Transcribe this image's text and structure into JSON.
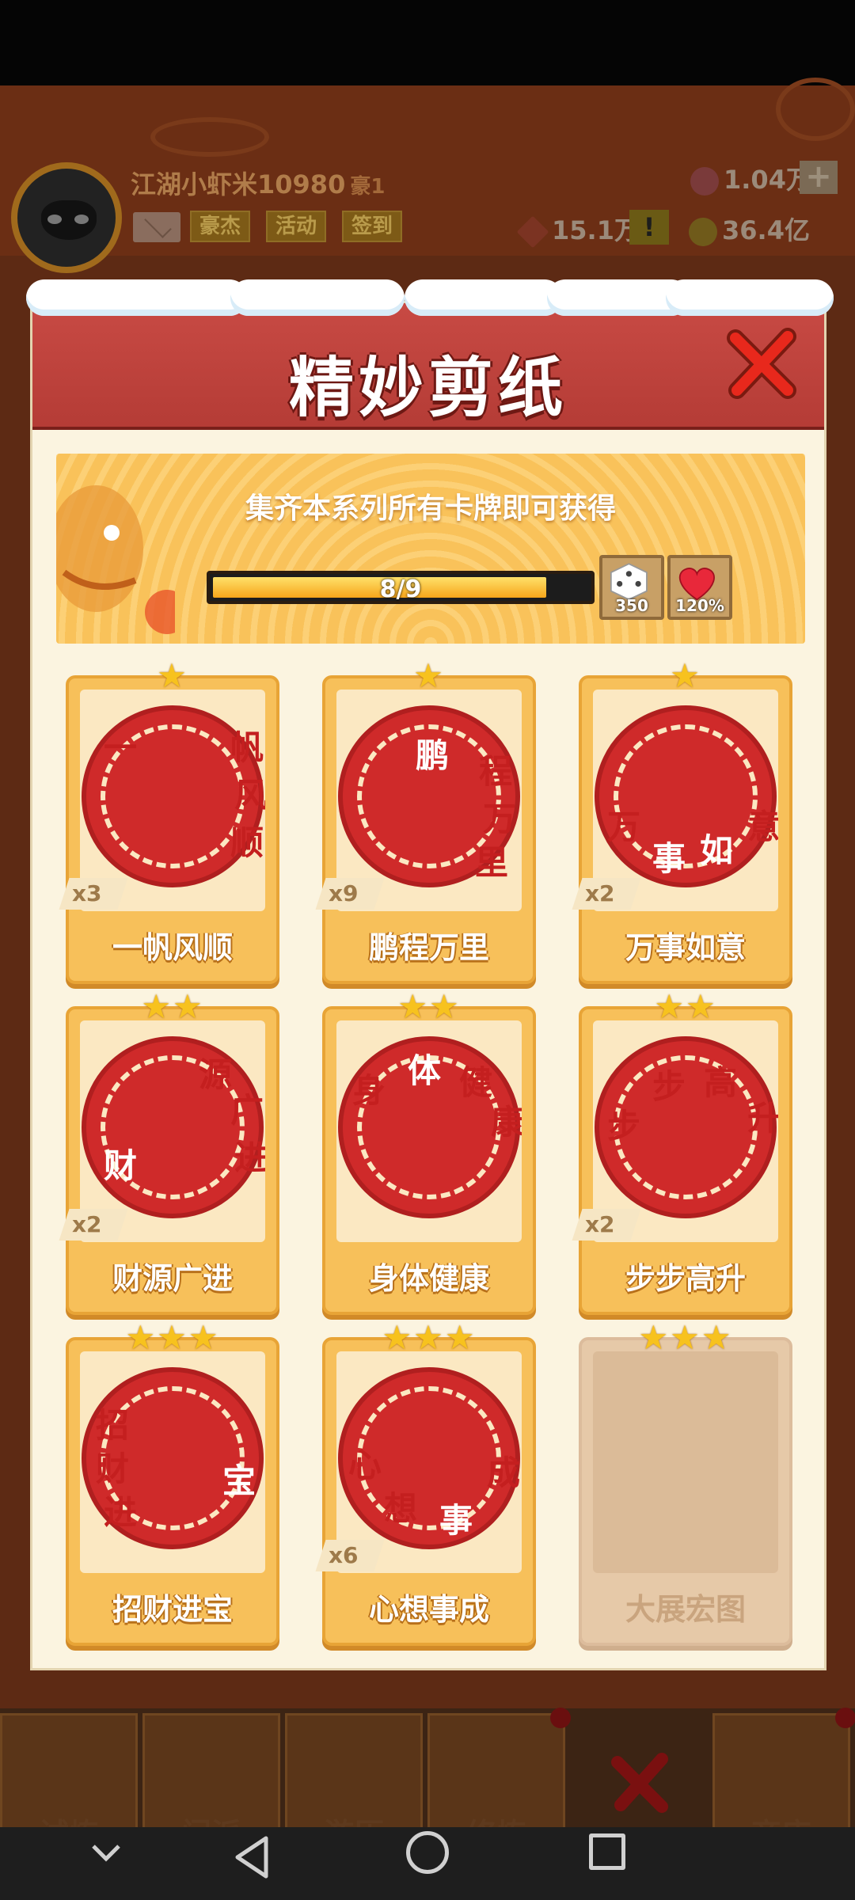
{
  "header": {
    "player_name": "江湖小虾米10980",
    "player_title": "豪1",
    "buttons": [
      "豪杰",
      "活动",
      "签到"
    ],
    "gems": "1.04万",
    "power": "15.1万",
    "coins": "36.4亿"
  },
  "modal": {
    "title": "精妙剪纸",
    "banner_text": "集齐本系列所有卡牌即可获得",
    "progress_label": "8/9",
    "progress_fraction": 0.889,
    "rewards": [
      {
        "icon": "dice-icon",
        "value": "350"
      },
      {
        "icon": "heart-icon",
        "value": "120%"
      }
    ]
  },
  "cards": [
    {
      "name": "一帆风顺",
      "count": "x3",
      "stars": "★",
      "chars": [
        "一",
        "帆",
        "风",
        "顺"
      ]
    },
    {
      "name": "鹏程万里",
      "count": "x9",
      "stars": "★",
      "chars": [
        "鹏",
        "程",
        "万",
        "里"
      ]
    },
    {
      "name": "万事如意",
      "count": "x2",
      "stars": "★",
      "chars": [
        "万",
        "事",
        "如",
        "意"
      ]
    },
    {
      "name": "财源广进",
      "count": "x2",
      "stars": "★★",
      "chars": [
        "财",
        "源",
        "广",
        "进"
      ]
    },
    {
      "name": "身体健康",
      "count": "",
      "stars": "★★",
      "chars": [
        "身",
        "体",
        "健",
        "康"
      ]
    },
    {
      "name": "步步高升",
      "count": "x2",
      "stars": "★★",
      "chars": [
        "步",
        "步",
        "高",
        "升"
      ]
    },
    {
      "name": "招财进宝",
      "count": "",
      "stars": "★★★",
      "chars": [
        "招",
        "财",
        "进",
        "宝"
      ]
    },
    {
      "name": "心想事成",
      "count": "x6",
      "stars": "★★★",
      "chars": [
        "心",
        "想",
        "事",
        "成"
      ]
    },
    {
      "name": "大展宏图",
      "count": "",
      "stars": "★★★",
      "locked": true
    }
  ],
  "bottom_nav": [
    "试炼",
    "门派",
    "游历",
    "修炼",
    "",
    "商店"
  ]
}
